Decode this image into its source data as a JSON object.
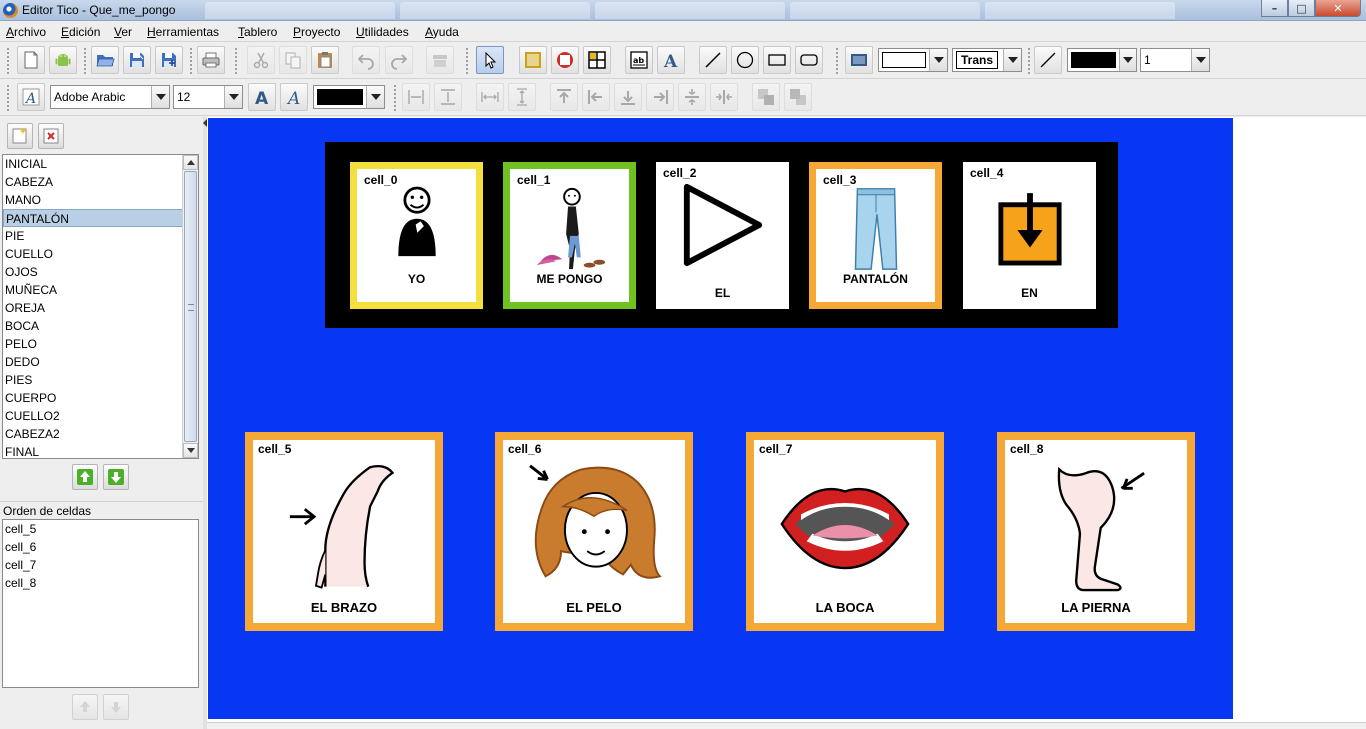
{
  "window": {
    "title": "Editor Tico - Que_me_pongo",
    "minimize": "–",
    "maximize": "□",
    "close": "✕"
  },
  "menu": [
    "Archivo",
    "Edición",
    "Ver",
    "Herramientas",
    "Tablero",
    "Proyecto",
    "Utilidades",
    "Ayuda"
  ],
  "toolbar": {
    "fill_color_hex": "#ffffff",
    "transparency_value": "Trans",
    "line_color_hex": "#000000",
    "line_width": "1",
    "font_family": "Adobe Arabic",
    "font_size": "12",
    "text_color_hex": "#000000"
  },
  "boards_list": {
    "items": [
      "INICIAL",
      "CABEZA",
      "MANO",
      "PANTALÓN",
      "PIE",
      "CUELLO",
      "OJOS",
      "MUÑECA",
      "OREJA",
      "BOCA",
      "PELO",
      "DEDO",
      "PIES",
      "CUERPO",
      "CUELLO2",
      "CABEZA2",
      "FINAL"
    ],
    "selected_index": 3
  },
  "cell_order": {
    "label": "Orden de celdas",
    "items": [
      "cell_5",
      "cell_6",
      "cell_7",
      "cell_8"
    ]
  },
  "board": {
    "background_hex": "#0737f3",
    "sentence_cells": [
      {
        "id": "cell_0",
        "label": "YO",
        "border_hex": "#f4e03d",
        "icon": "person-icon"
      },
      {
        "id": "cell_1",
        "label": "ME PONGO",
        "border_hex": "#6fc21f",
        "icon": "dressing-person-icon"
      },
      {
        "id": "cell_2",
        "label": "EL",
        "border_hex": "#ffffff",
        "icon": "play-triangle-icon"
      },
      {
        "id": "cell_3",
        "label": "PANTALÓN",
        "border_hex": "#f6a836",
        "icon": "trousers-icon"
      },
      {
        "id": "cell_4",
        "label": "EN",
        "border_hex": "#ffffff",
        "icon": "arrow-into-box-icon"
      }
    ],
    "choice_cells": [
      {
        "id": "cell_5",
        "label": "EL BRAZO",
        "border_hex": "#f6a836",
        "icon": "arm-icon"
      },
      {
        "id": "cell_6",
        "label": "EL PELO",
        "border_hex": "#f6a836",
        "icon": "hair-icon"
      },
      {
        "id": "cell_7",
        "label": "LA BOCA",
        "border_hex": "#f6a836",
        "icon": "mouth-icon"
      },
      {
        "id": "cell_8",
        "label": "LA PIERNA",
        "border_hex": "#f6a836",
        "icon": "leg-icon"
      }
    ]
  }
}
